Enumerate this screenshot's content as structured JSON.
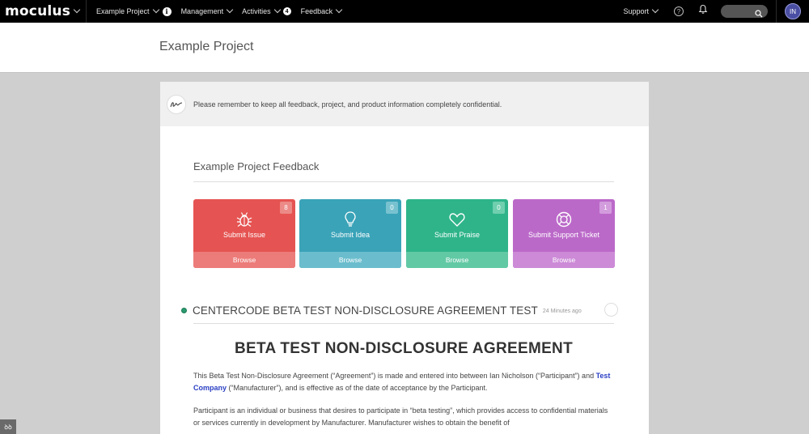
{
  "nav": {
    "brand": "moculus",
    "items": [
      {
        "label": "Example Project"
      },
      {
        "label": "Management"
      },
      {
        "label": "Activities",
        "badge": "4"
      },
      {
        "label": "Feedback"
      }
    ],
    "support": "Support",
    "help_glyph": "?",
    "info_glyph": "i",
    "avatar_initials": "IN",
    "search_placeholder": ""
  },
  "page": {
    "title": "Example Project"
  },
  "notice": {
    "text": "Please remember to keep all feedback, project, and product information completely confidential."
  },
  "feedback": {
    "title": "Example Project Feedback",
    "browse_label": "Browse",
    "tiles": [
      {
        "label": "Submit Issue",
        "count": "8",
        "icon": "bug-icon",
        "color": "#e55452"
      },
      {
        "label": "Submit Idea",
        "count": "0",
        "icon": "lightbulb-icon",
        "color": "#3aa3b8"
      },
      {
        "label": "Submit Praise",
        "count": "0",
        "icon": "heart-icon",
        "color": "#2fb48a"
      },
      {
        "label": "Submit Support Ticket",
        "count": "1",
        "icon": "lifebuoy-icon",
        "color": "#bb69c9"
      }
    ]
  },
  "agreement": {
    "heading": "CENTERCODE BETA TEST NON-DISCLOSURE AGREEMENT TEST",
    "time": "24 Minutes ago",
    "doc_title": "BETA TEST NON-DISCLOSURE AGREEMENT",
    "p1_before": "This Beta Test Non-Disclosure Agreement (“Agreement”) is made and entered into between Ian Nicholson (“Participant”) and ",
    "p1_link": "Test Company",
    "p1_after": " (“Manufacturer”), and is effective as of the date of acceptance by the Participant.",
    "p2": "Participant is an individual or business that desires to participate in “beta testing”, which provides access to confidential materials or services currently in development by Manufacturer. Manufacturer wishes to obtain the benefit of"
  },
  "widget": {
    "label": "ꝺꝺ"
  }
}
